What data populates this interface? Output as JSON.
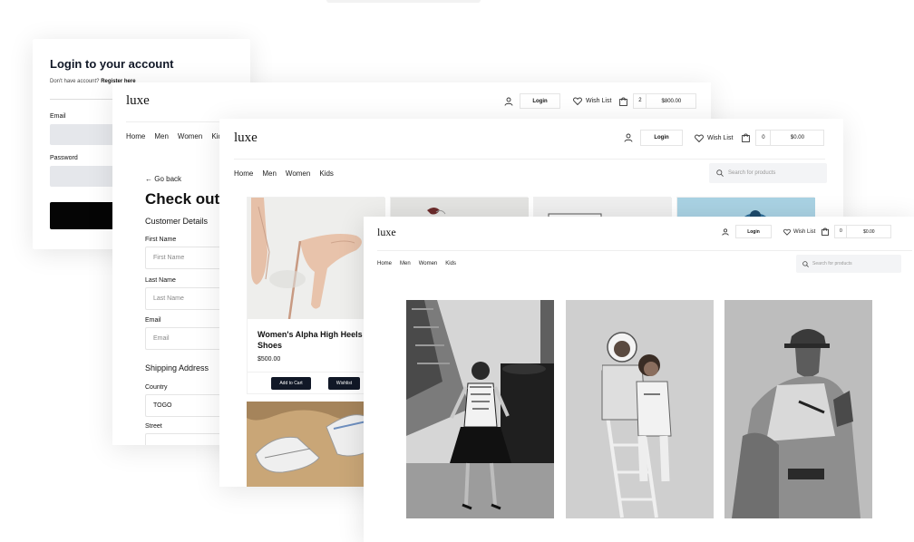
{
  "brand": {
    "logo": "luxe"
  },
  "nav": {
    "home": "Home",
    "men": "Men",
    "women": "Women",
    "kids": "Kids"
  },
  "header": {
    "login": "Login",
    "wishlist": "Wish List"
  },
  "login_card": {
    "title": "Login to your account",
    "no_account": "Don't have account?",
    "register_link": "Register here",
    "email_label": "Email",
    "password_label": "Password"
  },
  "checkout_card": {
    "cart_count": "2",
    "cart_total": "$800.00",
    "back": "← Go back",
    "title": "Check out",
    "customer_section": "Customer Details",
    "first_name_label": "First Name",
    "first_name_placeholder": "First Name",
    "last_name_label": "Last Name",
    "last_name_placeholder": "Last Name",
    "email_label": "Email",
    "email_placeholder": "Email",
    "shipping_section": "Shipping Address",
    "country_label": "Country",
    "country_value": "TOGO",
    "street_label": "Street"
  },
  "shop_card": {
    "cart_count": "0",
    "cart_total": "$0.00",
    "search_placeholder": "Search for products",
    "product": {
      "name": "Women's Alpha High Heels Shoes",
      "price": "$500.00",
      "add_to_cart": "Add to Cart",
      "wishlist": "Wishlist"
    }
  },
  "front_card": {
    "cart_count": "0",
    "cart_total": "$0.00",
    "search_placeholder": "Search for products"
  },
  "icons": {
    "user": "user-icon",
    "heart": "heart-icon",
    "cart": "shopping-bag-icon",
    "search": "search-icon",
    "back": "arrow-left-icon"
  },
  "colors": {
    "primary_button": "#111827",
    "login_button": "#050505",
    "field_bg": "#e5e7eb",
    "search_bg": "#f3f4f6"
  }
}
